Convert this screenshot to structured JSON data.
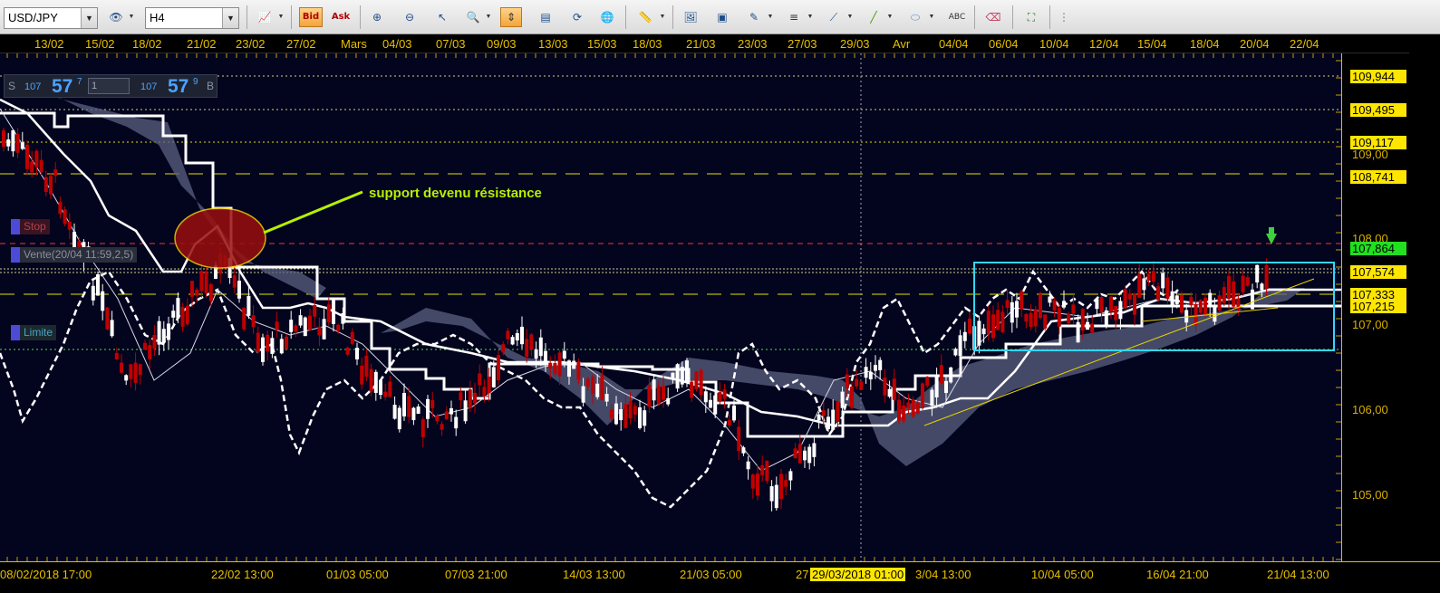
{
  "toolbar": {
    "symbol": "USD/JPY",
    "timeframe": "H4",
    "bid_label": "Bid",
    "ask_label": "Ask"
  },
  "trade_panel": {
    "sell_side_letter": "S",
    "sell_small": "107",
    "sell_big": "57",
    "sell_sup": "7",
    "quantity": "1",
    "buy_small": "107",
    "buy_big": "57",
    "buy_sup": "9",
    "buy_side_letter": "B"
  },
  "orders": {
    "stop_label": "Stop",
    "sell_label": "Vente(20/04 11:59,2,5)",
    "limit_label": "Limite"
  },
  "annotation": "support devenu résistance",
  "top_dates": [
    "13/02",
    "15/02",
    "18/02",
    "21/02",
    "23/02",
    "27/02",
    "Mars",
    "04/03",
    "07/03",
    "09/03",
    "13/03",
    "15/03",
    "18/03",
    "21/03",
    "23/03",
    "27/03",
    "29/03",
    "Avr",
    "04/04",
    "06/04",
    "10/04",
    "12/04",
    "15/04",
    "18/04",
    "20/04",
    "22/04"
  ],
  "bottom_dates": [
    "08/02/2018 17:00",
    "22/02 13:00",
    "01/03 05:00",
    "07/03 21:00",
    "14/03 13:00",
    "21/03 05:00",
    "27",
    "29/03/2018 01:00",
    "3/04 13:00",
    "10/04 05:00",
    "16/04 21:00",
    "21/04 13:00"
  ],
  "price_axis": {
    "grid_labels": [
      "109,00",
      "108,00",
      "107,00",
      "106,00",
      "105,00"
    ],
    "level_labels": [
      "109,944",
      "109,495",
      "109,117",
      "108,741",
      "107,864",
      "107,574",
      "107,333",
      "107,215"
    ]
  },
  "colors": {
    "chart_background": "#03041e",
    "axis_text": "#e8c000",
    "bullish_candle": "#ffffff",
    "bearish_candle": "#c00000",
    "cloud": "#5b6080",
    "range_box": "#33d6ff",
    "annotation": "#b6f000",
    "last_price": "#20e020"
  }
}
